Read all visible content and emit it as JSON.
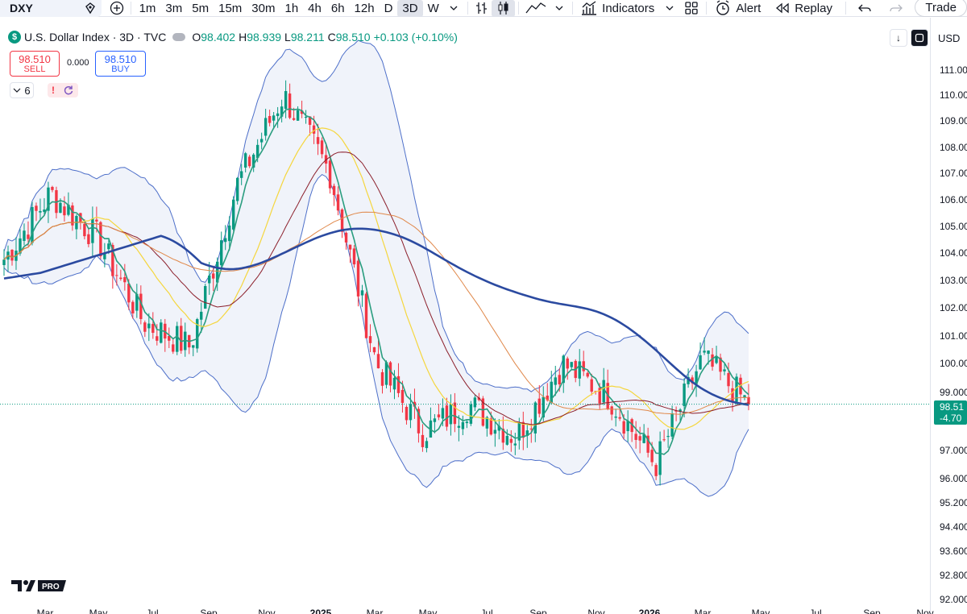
{
  "toolbar": {
    "symbol": "DXY",
    "timeframes": [
      "1m",
      "3m",
      "5m",
      "15m",
      "30m",
      "1h",
      "4h",
      "6h",
      "12h",
      "D",
      "3D",
      "W"
    ],
    "active_timeframe": "3D",
    "indicators_label": "Indicators",
    "alert_label": "Alert",
    "replay_label": "Replay",
    "trade_label": "Trade"
  },
  "legend": {
    "title": "U.S. Dollar Index · 3D · TVC",
    "o_key": "O",
    "o_val": "98.402",
    "h_key": "H",
    "h_val": "98.939",
    "l_key": "L",
    "l_val": "98.211",
    "c_key": "C",
    "c_val": "98.510",
    "change": "+0.103 (+0.10%)"
  },
  "trade": {
    "sell_price": "98.510",
    "sell_label": "SELL",
    "spread": "0.000",
    "buy_price": "98.510",
    "buy_label": "BUY"
  },
  "indicator_count": "6",
  "currency": "USD",
  "last_price": {
    "price": "98.51",
    "change": "-4.70"
  },
  "colors": {
    "up": "#089981",
    "down": "#f23645",
    "accent": "#2962ff",
    "ma200": "#2b4aa0",
    "bb": "#4d6fc9",
    "ma_yellow": "#f5d63d",
    "ma_orange": "#e0884a",
    "ma_brown": "#8b1e2a",
    "ma_green": "#2a9d7f"
  },
  "price_axis": [
    "111.00",
    "110.00",
    "109.00",
    "108.00",
    "107.00",
    "106.00",
    "105.00",
    "104.00",
    "103.00",
    "102.00",
    "101.00",
    "100.00",
    "99.000",
    "98.51",
    "97.000",
    "96.000",
    "95.200",
    "94.400",
    "93.600",
    "92.800",
    "92.000"
  ],
  "time_axis": [
    {
      "label": "Mar",
      "bold": false
    },
    {
      "label": "May",
      "bold": false
    },
    {
      "label": "Jul",
      "bold": false
    },
    {
      "label": "Sep",
      "bold": false
    },
    {
      "label": "Nov",
      "bold": false
    },
    {
      "label": "2025",
      "bold": true
    },
    {
      "label": "Mar",
      "bold": false
    },
    {
      "label": "May",
      "bold": false
    },
    {
      "label": "Jul",
      "bold": false
    },
    {
      "label": "Sep",
      "bold": false
    },
    {
      "label": "Nov",
      "bold": false
    },
    {
      "label": "2026",
      "bold": true
    },
    {
      "label": "Mar",
      "bold": false
    },
    {
      "label": "May",
      "bold": false
    },
    {
      "label": "Jul",
      "bold": false
    },
    {
      "label": "Sep",
      "bold": false
    },
    {
      "label": "Nov",
      "bold": false
    }
  ],
  "logo_text": "PRO",
  "chart_data": {
    "type": "candlestick",
    "key_closes": [
      {
        "t": "2024-Feb",
        "price": 103.8
      },
      {
        "t": "2024-Apr",
        "price": 106.2
      },
      {
        "t": "2024-Jun",
        "price": 104.6
      },
      {
        "t": "2024-Aug",
        "price": 101.5
      },
      {
        "t": "2024-Sep",
        "price": 100.6
      },
      {
        "t": "2024-Nov",
        "price": 106.5
      },
      {
        "t": "2025-Jan",
        "price": 109.8
      },
      {
        "t": "2025-Feb",
        "price": 107.0
      },
      {
        "t": "2025-Apr",
        "price": 100.0
      },
      {
        "t": "2025-Jun",
        "price": 97.5
      },
      {
        "t": "2025-Aug",
        "price": 98.5
      },
      {
        "t": "2025-Sep",
        "price": 97.3
      },
      {
        "t": "2025-Nov",
        "price": 100.0
      },
      {
        "t": "2025-Dec",
        "price": 98.8
      },
      {
        "t": "2026-Jan",
        "price": 96.3
      },
      {
        "t": "2026-Mar",
        "price": 100.2
      },
      {
        "t": "2026-Apr",
        "price": 98.51
      }
    ]
  }
}
